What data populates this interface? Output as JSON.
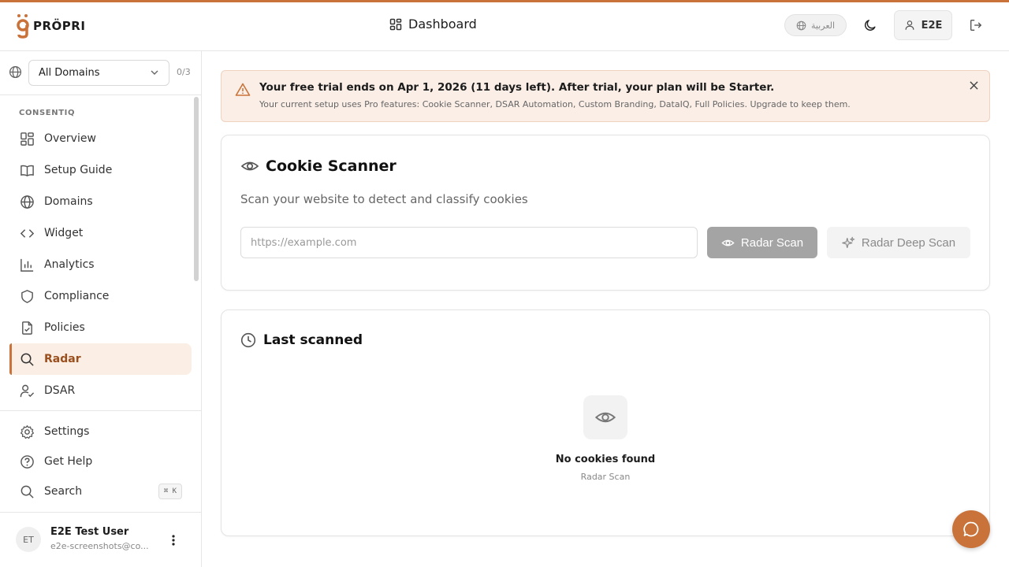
{
  "header": {
    "title": "Dashboard",
    "language": "العربية",
    "user_button": "E2E",
    "logo_text": "PRÖPRI"
  },
  "sidebar": {
    "domain_select": "All Domains",
    "domain_count": "0/3",
    "section_label": "CONSENTIQ",
    "items": [
      {
        "label": "Overview",
        "icon": "grid-icon"
      },
      {
        "label": "Setup Guide",
        "icon": "book-icon"
      },
      {
        "label": "Domains",
        "icon": "globe-icon"
      },
      {
        "label": "Widget",
        "icon": "code-icon"
      },
      {
        "label": "Analytics",
        "icon": "bar-chart-icon"
      },
      {
        "label": "Compliance",
        "icon": "shield-icon"
      },
      {
        "label": "Policies",
        "icon": "file-check-icon"
      },
      {
        "label": "Radar",
        "icon": "search-icon",
        "active": true
      },
      {
        "label": "DSAR",
        "icon": "user-check-icon"
      }
    ],
    "bottom": {
      "settings": "Settings",
      "help": "Get Help",
      "search": "Search",
      "search_shortcut": "⌘ K"
    },
    "user": {
      "initials": "ET",
      "name": "E2E Test User",
      "email": "e2e-screenshots@co..."
    }
  },
  "banner": {
    "title": "Your free trial ends on Apr 1, 2026 (11 days left). After trial, your plan will be Starter.",
    "subtitle": "Your current setup uses Pro features: Cookie Scanner, DSAR Automation, Custom Branding, DataIQ, Full Policies. Upgrade to keep them."
  },
  "scanner": {
    "title": "Cookie Scanner",
    "subtitle": "Scan your website to detect and classify cookies",
    "url_placeholder": "https://example.com",
    "url_value": "",
    "scan_button": "Radar Scan",
    "deep_scan_button": "Radar Deep Scan"
  },
  "last_scanned": {
    "title": "Last scanned",
    "empty_title": "No cookies found",
    "empty_subtitle": "Radar Scan"
  },
  "colors": {
    "accent": "#c9733a",
    "active_bg": "#fbeee4",
    "banner_bg": "#faeee6"
  }
}
